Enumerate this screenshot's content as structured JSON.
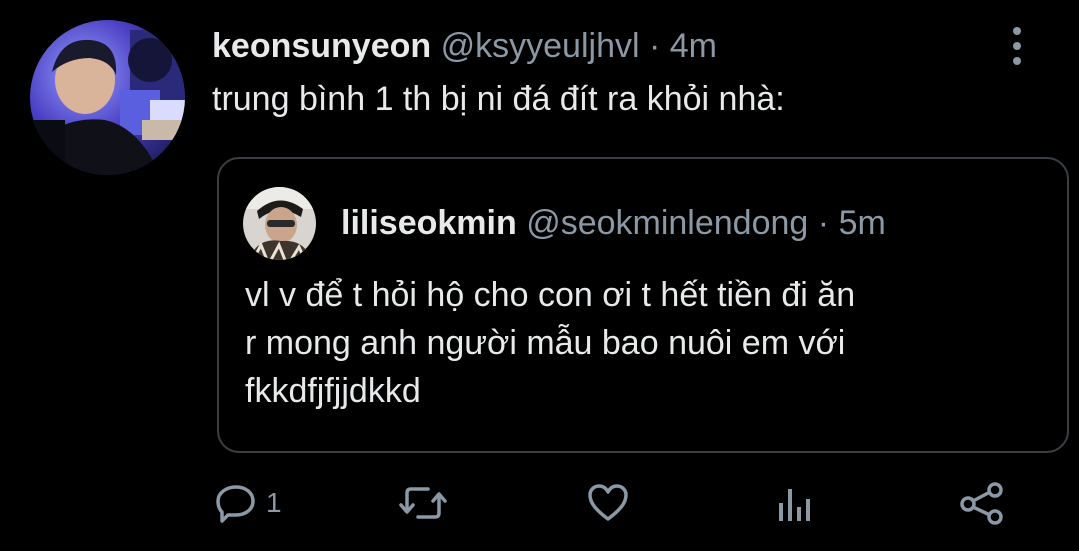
{
  "tweet": {
    "display_name": "keonsunyeon",
    "handle": "@ksyyeuljhvl",
    "separator": "·",
    "time": "4m",
    "text": "trung bình 1 th bị ni đá đít ra khỏi nhà:"
  },
  "quoted_tweet": {
    "display_name": "liliseokmin",
    "handle": "@seokminlendong",
    "separator": "·",
    "time": "5m",
    "text_lines": [
      "vl v để t hỏi hộ cho con ơi t hết tiền đi ăn",
      "r mong anh người mẫu bao nuôi em với",
      "fkkdfjfjjdkkd"
    ]
  },
  "actions": {
    "reply_count": "1",
    "icons": [
      "reply-icon",
      "retweet-icon",
      "like-icon",
      "analytics-icon",
      "share-icon",
      "more-vertical-icon"
    ]
  },
  "colors": {
    "background": "#000000",
    "text_primary": "#e7e9ea",
    "text_secondary": "#8b98a5",
    "border": "#3a3f44"
  }
}
